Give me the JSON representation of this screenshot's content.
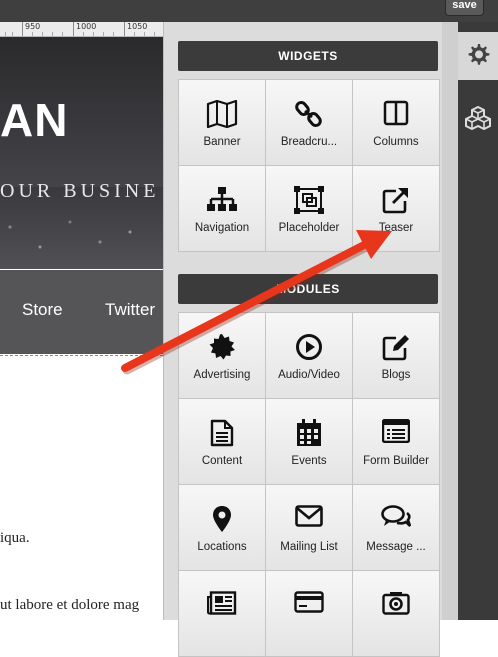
{
  "toolbar": {
    "save_label": "save"
  },
  "ruler": {
    "ticks": [
      "950",
      "1000",
      "1050"
    ]
  },
  "site": {
    "logo_text": "AN",
    "tagline": "OUR BUSINE",
    "nav": [
      "Store",
      "Twitter"
    ],
    "body_lines": [
      "iqua.",
      "ut labore et dolore mag"
    ]
  },
  "panel": {
    "widgets_title": "WIDGETS",
    "widgets": [
      {
        "label": "Banner",
        "icon": "map-icon"
      },
      {
        "label": "Breadcru...",
        "icon": "chain-link-icon"
      },
      {
        "label": "Columns",
        "icon": "columns-icon"
      },
      {
        "label": "Navigation",
        "icon": "sitemap-icon"
      },
      {
        "label": "Placeholder",
        "icon": "placeholder-icon"
      },
      {
        "label": "Teaser",
        "icon": "external-link-icon"
      }
    ],
    "modules_title": "MODULES",
    "modules": [
      {
        "label": "Advertising",
        "icon": "badge-icon"
      },
      {
        "label": "Audio/Video",
        "icon": "play-icon"
      },
      {
        "label": "Blogs",
        "icon": "edit-icon"
      },
      {
        "label": "Content",
        "icon": "document-icon"
      },
      {
        "label": "Events",
        "icon": "calendar-icon"
      },
      {
        "label": "Form Builder",
        "icon": "form-icon"
      },
      {
        "label": "Locations",
        "icon": "map-pin-icon"
      },
      {
        "label": "Mailing List",
        "icon": "envelope-icon"
      },
      {
        "label": "Message ...",
        "icon": "chat-bubbles-icon"
      },
      {
        "label": "",
        "icon": "newspaper-icon"
      },
      {
        "label": "",
        "icon": "credit-card-icon"
      },
      {
        "label": "",
        "icon": "camera-icon"
      }
    ]
  },
  "sidebar": {
    "icons": [
      "gear-icon",
      "cube-icon"
    ]
  },
  "annotation": {
    "arrow_color": "#e8361c"
  }
}
